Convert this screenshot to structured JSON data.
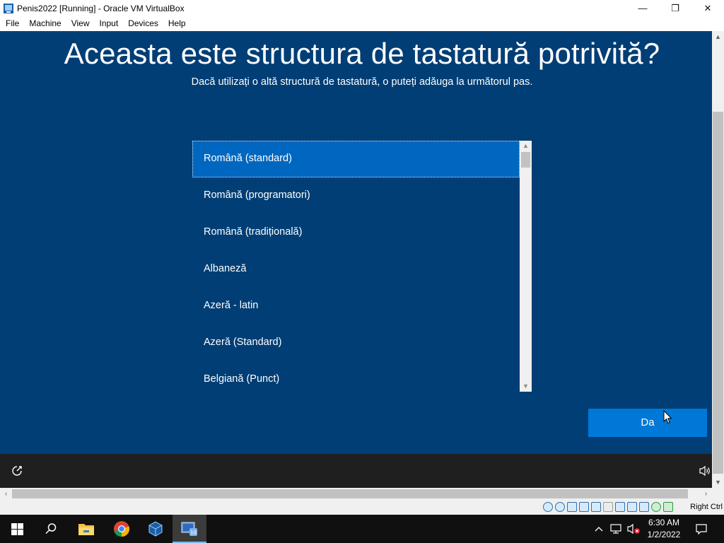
{
  "window": {
    "title": "Penis2022 [Running] - Oracle VM VirtualBox",
    "minimize_glyph": "—",
    "maximize_glyph": "❐",
    "close_glyph": "✕"
  },
  "menu": {
    "items": [
      "File",
      "Machine",
      "View",
      "Input",
      "Devices",
      "Help"
    ]
  },
  "setup": {
    "heading": "Aceasta este structura de tastatură potrivită?",
    "subheading": "Dacă utilizați o altă structură de tastatură, o puteți adăuga la următorul pas.",
    "layouts": [
      "Română (standard)",
      "Română (programatori)",
      "Română (tradițională)",
      "Albaneză",
      "Azeră - latin",
      "Azeră (Standard)",
      "Belgiană (Punct)"
    ],
    "selected_index": 0,
    "confirm_button": "Da"
  },
  "statusbar": {
    "host_key": "Right Ctrl",
    "icons": [
      "hard-disk-icon",
      "optical-drive-icon",
      "audio-icon",
      "network-icon",
      "usb-icon",
      "shared-folders-icon",
      "display-icon",
      "video-capture-icon",
      "cpu-icon",
      "mouse-integration-icon",
      "keyboard-icon"
    ]
  },
  "taskbar": {
    "apps": [
      "start-icon",
      "search-icon",
      "file-explorer-icon",
      "chrome-icon",
      "virtualbox-manager-icon",
      "virtualbox-vm-icon"
    ],
    "time": "6:30 AM",
    "date": "1/2/2022"
  },
  "colors": {
    "oobe_background": "#003E75",
    "selection": "#0067C0",
    "accent_button": "#0078D7",
    "taskbar": "#101010"
  }
}
